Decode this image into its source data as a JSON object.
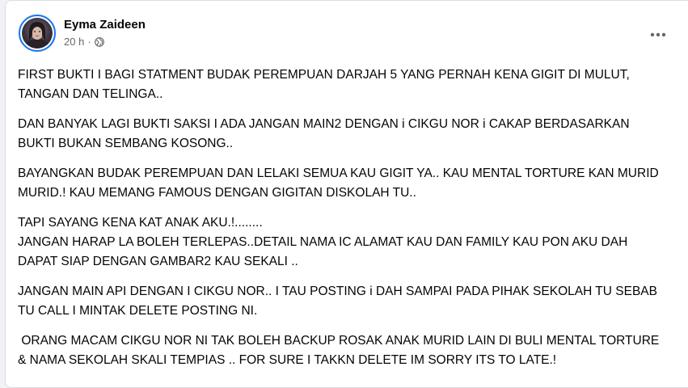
{
  "post": {
    "author": "Eyma Zaideen",
    "time": "20 h",
    "separator": "·",
    "privacy_icon": "globe-icon",
    "more_icon": "more-horizontal-icon",
    "paragraphs": [
      "FIRST BUKTI I BAGI STATMENT BUDAK PEREMPUAN DARJAH 5 YANG PERNAH KENA GIGIT DI MULUT, TANGAN DAN TELINGA..",
      "DAN BANYAK LAGI BUKTI SAKSI I ADA JANGAN MAIN2 DENGAN i CIKGU NOR i CAKAP BERDASARKAN BUKTI BUKAN SEMBANG KOSONG..",
      "BAYANGKAN BUDAK PEREMPUAN DAN LELAKI SEMUA KAU GIGIT YA.. KAU MENTAL TORTURE KAN MURID MURID.! KAU MEMANG FAMOUS DENGAN GIGITAN DISKOLAH TU..",
      "TAPI SAYANG KENA KAT ANAK AKU.!........\nJANGAN HARAP LA BOLEH TERLEPAS..DETAIL NAMA IC ALAMAT KAU DAN FAMILY KAU PON AKU DAH DAPAT SIAP DENGAN GAMBAR2 KAU SEKALI ..",
      "JANGAN MAIN API DENGAN I CIKGU NOR.. I TAU POSTING i DAH SAMPAI PADA PIHAK SEKOLAH TU SEBAB TU CALL I MINTAK DELETE POSTING NI.",
      " ORANG MACAM CIKGU NOR NI TAK BOLEH BACKUP ROSAK ANAK MURID LAIN DI BULI MENTAL TORTURE & NAMA SEKOLAH SKALI TEMPIAS .. FOR SURE I TAKKN DELETE IM SORRY ITS TO LATE.!"
    ]
  },
  "colors": {
    "accent": "#1877f2",
    "text": "#050505",
    "secondary_text": "#65676b",
    "page_bg": "#f0f2f5",
    "card_bg": "#ffffff"
  }
}
